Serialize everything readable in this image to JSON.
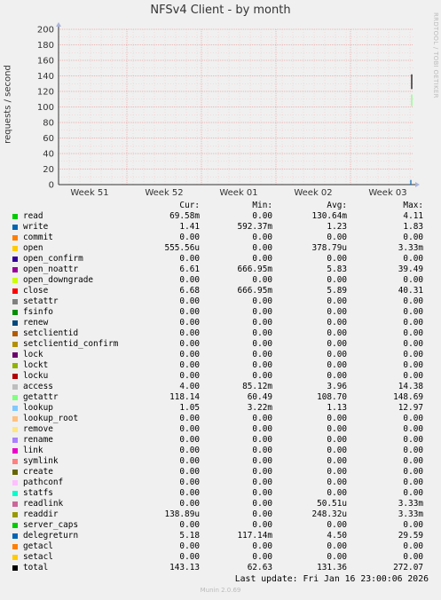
{
  "header": {
    "title": "NFSv4 Client - by month",
    "side_label": "RRDTOOL / TOBI OETIKER"
  },
  "chart_data": {
    "type": "line",
    "title": "NFSv4 Client - by month",
    "ylabel": "requests / second",
    "ylim": [
      0,
      200
    ],
    "yticks": [
      0,
      20,
      40,
      60,
      80,
      100,
      120,
      140,
      160,
      180,
      200
    ],
    "xticks": [
      "Week 51",
      "Week 52",
      "Week 01",
      "Week 02",
      "Week 03"
    ],
    "grid": true,
    "series": [
      {
        "name": "total",
        "color": "#000000",
        "x": [
          "Week 03",
          "Week 03"
        ],
        "values": [
          123,
          142
        ]
      },
      {
        "name": "getattr",
        "color": "#7FFF7F",
        "x": [
          "Week 03",
          "Week 03"
        ],
        "values": [
          101,
          116
        ]
      },
      {
        "name": "write",
        "color": "#0066B3",
        "x": [
          "Week 03",
          "Week 03"
        ],
        "values": [
          0,
          6
        ]
      }
    ]
  },
  "legend": {
    "headers": [
      "Cur:",
      "Min:",
      "Avg:",
      "Max:"
    ],
    "rows": [
      {
        "name": "read",
        "color": "#00CC00",
        "cur": "69.58m",
        "min": "0.00",
        "avg": "130.64m",
        "max": "4.11"
      },
      {
        "name": "write",
        "color": "#0066B3",
        "cur": "1.41",
        "min": "592.37m",
        "avg": "1.23",
        "max": "1.83"
      },
      {
        "name": "commit",
        "color": "#FF8000",
        "cur": "0.00",
        "min": "0.00",
        "avg": "0.00",
        "max": "0.00"
      },
      {
        "name": "open",
        "color": "#FFCC00",
        "cur": "555.56u",
        "min": "0.00",
        "avg": "378.79u",
        "max": "3.33m"
      },
      {
        "name": "open_confirm",
        "color": "#330099",
        "cur": "0.00",
        "min": "0.00",
        "avg": "0.00",
        "max": "0.00"
      },
      {
        "name": "open_noattr",
        "color": "#990099",
        "cur": "6.61",
        "min": "666.95m",
        "avg": "5.83",
        "max": "39.49"
      },
      {
        "name": "open_downgrade",
        "color": "#CCFF00",
        "cur": "0.00",
        "min": "0.00",
        "avg": "0.00",
        "max": "0.00"
      },
      {
        "name": "close",
        "color": "#FF0000",
        "cur": "6.68",
        "min": "666.95m",
        "avg": "5.89",
        "max": "40.31"
      },
      {
        "name": "setattr",
        "color": "#808080",
        "cur": "0.00",
        "min": "0.00",
        "avg": "0.00",
        "max": "0.00"
      },
      {
        "name": "fsinfo",
        "color": "#008F00",
        "cur": "0.00",
        "min": "0.00",
        "avg": "0.00",
        "max": "0.00"
      },
      {
        "name": "renew",
        "color": "#00487D",
        "cur": "0.00",
        "min": "0.00",
        "avg": "0.00",
        "max": "0.00"
      },
      {
        "name": "setclientid",
        "color": "#B35A00",
        "cur": "0.00",
        "min": "0.00",
        "avg": "0.00",
        "max": "0.00"
      },
      {
        "name": "setclientid_confirm",
        "color": "#B38F00",
        "cur": "0.00",
        "min": "0.00",
        "avg": "0.00",
        "max": "0.00"
      },
      {
        "name": "lock",
        "color": "#6B006B",
        "cur": "0.00",
        "min": "0.00",
        "avg": "0.00",
        "max": "0.00"
      },
      {
        "name": "lockt",
        "color": "#8FB300",
        "cur": "0.00",
        "min": "0.00",
        "avg": "0.00",
        "max": "0.00"
      },
      {
        "name": "locku",
        "color": "#B30000",
        "cur": "0.00",
        "min": "0.00",
        "avg": "0.00",
        "max": "0.00"
      },
      {
        "name": "access",
        "color": "#BEBEBE",
        "cur": "4.00",
        "min": "85.12m",
        "avg": "3.96",
        "max": "14.38"
      },
      {
        "name": "getattr",
        "color": "#80FF80",
        "cur": "118.14",
        "min": "60.49",
        "avg": "108.70",
        "max": "148.69"
      },
      {
        "name": "lookup",
        "color": "#80C9FF",
        "cur": "1.05",
        "min": "3.22m",
        "avg": "1.13",
        "max": "12.97"
      },
      {
        "name": "lookup_root",
        "color": "#FFC080",
        "cur": "0.00",
        "min": "0.00",
        "avg": "0.00",
        "max": "0.00"
      },
      {
        "name": "remove",
        "color": "#FFE680",
        "cur": "0.00",
        "min": "0.00",
        "avg": "0.00",
        "max": "0.00"
      },
      {
        "name": "rename",
        "color": "#AA80FF",
        "cur": "0.00",
        "min": "0.00",
        "avg": "0.00",
        "max": "0.00"
      },
      {
        "name": "link",
        "color": "#EE00CC",
        "cur": "0.00",
        "min": "0.00",
        "avg": "0.00",
        "max": "0.00"
      },
      {
        "name": "symlink",
        "color": "#FF8080",
        "cur": "0.00",
        "min": "0.00",
        "avg": "0.00",
        "max": "0.00"
      },
      {
        "name": "create",
        "color": "#666600",
        "cur": "0.00",
        "min": "0.00",
        "avg": "0.00",
        "max": "0.00"
      },
      {
        "name": "pathconf",
        "color": "#FFBFFF",
        "cur": "0.00",
        "min": "0.00",
        "avg": "0.00",
        "max": "0.00"
      },
      {
        "name": "statfs",
        "color": "#00FFCC",
        "cur": "0.00",
        "min": "0.00",
        "avg": "0.00",
        "max": "0.00"
      },
      {
        "name": "readlink",
        "color": "#CC6699",
        "cur": "0.00",
        "min": "0.00",
        "avg": "50.51u",
        "max": "3.33m"
      },
      {
        "name": "readdir",
        "color": "#999900",
        "cur": "138.89u",
        "min": "0.00",
        "avg": "248.32u",
        "max": "3.33m"
      },
      {
        "name": "server_caps",
        "color": "#00CC00",
        "cur": "0.00",
        "min": "0.00",
        "avg": "0.00",
        "max": "0.00"
      },
      {
        "name": "delegreturn",
        "color": "#0066B3",
        "cur": "5.18",
        "min": "117.14m",
        "avg": "4.50",
        "max": "29.59"
      },
      {
        "name": "getacl",
        "color": "#FF8000",
        "cur": "0.00",
        "min": "0.00",
        "avg": "0.00",
        "max": "0.00"
      },
      {
        "name": "setacl",
        "color": "#FFCC00",
        "cur": "0.00",
        "min": "0.00",
        "avg": "0.00",
        "max": "0.00"
      },
      {
        "name": "total",
        "color": "#000000",
        "cur": "143.13",
        "min": "62.63",
        "avg": "131.36",
        "max": "272.07"
      }
    ]
  },
  "footer": {
    "last_update": "Last update: Fri Jan 16 23:00:06 2026",
    "munin": "Munin 2.0.69"
  }
}
